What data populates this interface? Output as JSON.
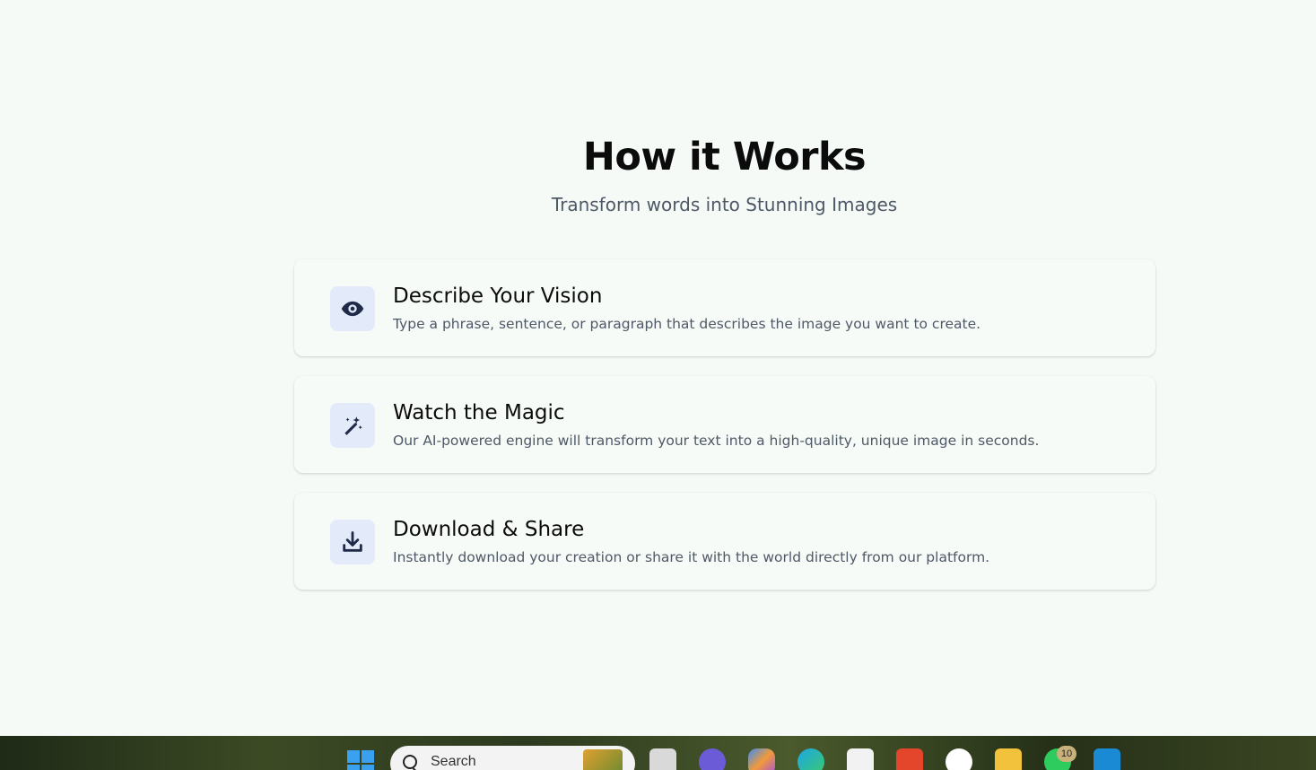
{
  "section": {
    "title": "How it Works",
    "subtitle": "Transform words into Stunning Images"
  },
  "steps": [
    {
      "icon": "eye-icon",
      "title": "Describe Your Vision",
      "description": "Type a phrase, sentence, or paragraph that describes the image you want to create."
    },
    {
      "icon": "magic-wand-icon",
      "title": "Watch the Magic",
      "description": "Our AI-powered engine will transform your text into a high-quality, unique image in seconds."
    },
    {
      "icon": "download-icon",
      "title": "Download & Share",
      "description": "Instantly download your creation or share it with the world directly from our platform."
    }
  ],
  "taskbar": {
    "search_placeholder": "Search",
    "notification_count": "10",
    "apps": [
      "start-icon",
      "task-view-icon",
      "video-call-icon",
      "copilot-icon",
      "edge-icon",
      "store-icon",
      "brave-icon",
      "key-app-icon",
      "file-explorer-icon",
      "whatsapp-icon",
      "vscode-icon"
    ]
  },
  "colors": {
    "background": "#f5faf7",
    "icon_bg": "#e3ebfb",
    "icon_fg": "#1e2a48",
    "muted_text": "#4f5866"
  }
}
